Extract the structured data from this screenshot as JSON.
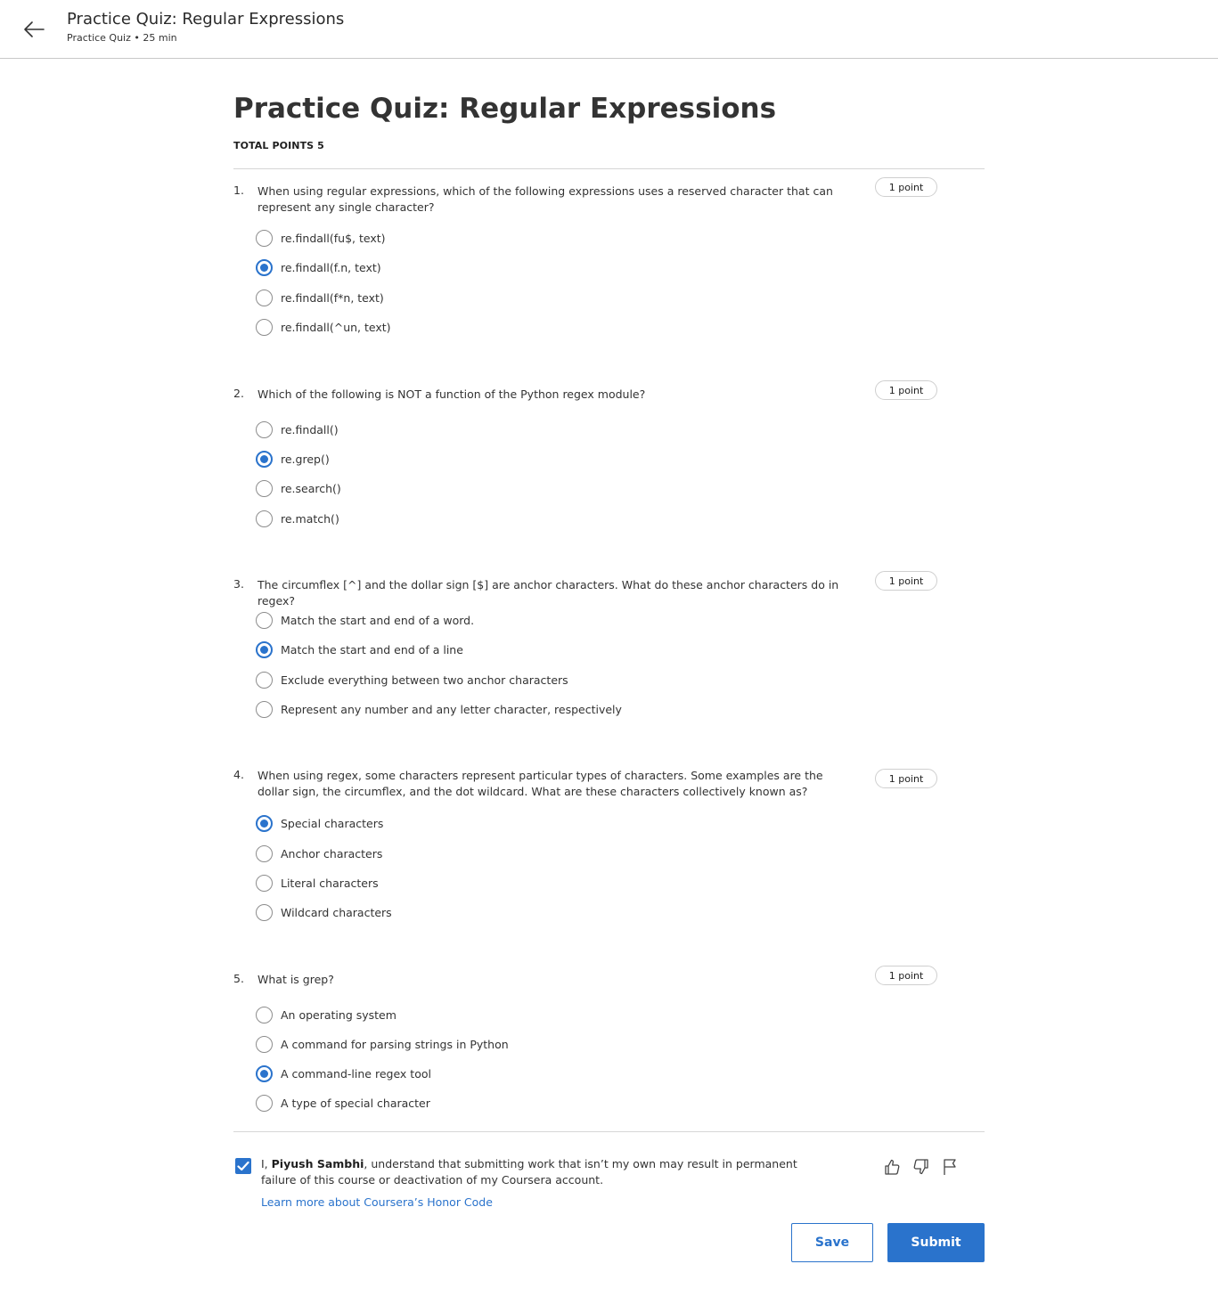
{
  "header": {
    "title": "Practice Quiz: Regular Expressions",
    "subtitle": "Practice Quiz • 25 min"
  },
  "quiz": {
    "title": "Practice Quiz: Regular Expressions",
    "total_points": "TOTAL POINTS 5",
    "questions": [
      {
        "number": "1.",
        "text": "When using regular expressions, which of the following expressions uses a reserved character that can represent any single character?",
        "points": "1 point",
        "options": [
          "re.findall(fu$, text)",
          "re.findall(f.n, text)",
          "re.findall(f*n, text)",
          "re.findall(^un, text)"
        ],
        "selected": 1
      },
      {
        "number": "2.",
        "text": "Which of the following is NOT a function of the Python regex module?",
        "points": "1 point",
        "options": [
          "re.findall()",
          "re.grep()",
          "re.search()",
          "re.match()"
        ],
        "selected": 1
      },
      {
        "number": "3.",
        "text": "The circumflex [^] and the dollar sign [$] are anchor characters. What do these anchor characters do in regex?",
        "points": "1 point",
        "options": [
          "Match the start and end of a word.",
          "Match the start and end of a line",
          "Exclude everything between two anchor characters",
          "Represent any number and any letter character, respectively"
        ],
        "selected": 1
      },
      {
        "number": "4.",
        "text": "When using regex, some characters represent particular types of characters. Some examples are the dollar sign, the circumflex, and the dot wildcard. What are these characters collectively known as?",
        "points": "1 point",
        "options": [
          "Special characters",
          "Anchor characters",
          "Literal characters",
          "Wildcard characters"
        ],
        "selected": 0
      },
      {
        "number": "5.",
        "text": "What is grep?",
        "points": "1 point",
        "options": [
          "An operating system",
          "A command for parsing strings in Python",
          "A command-line regex tool",
          "A type of special character"
        ],
        "selected": 2
      }
    ]
  },
  "honor": {
    "prefix": "I, ",
    "name": "Piyush Sambhi",
    "suffix": ", understand that submitting work that isn’t my own may result in permanent failure of this course or deactivation of my Coursera account.",
    "link": "Learn more about Coursera’s Honor Code",
    "checked": true
  },
  "buttons": {
    "save": "Save",
    "submit": "Submit"
  },
  "colors": {
    "accent": "#2a73cc"
  },
  "icons": [
    "arrow-left-icon",
    "thumbs-up-icon",
    "thumbs-down-icon",
    "flag-icon",
    "checkmark-icon"
  ]
}
